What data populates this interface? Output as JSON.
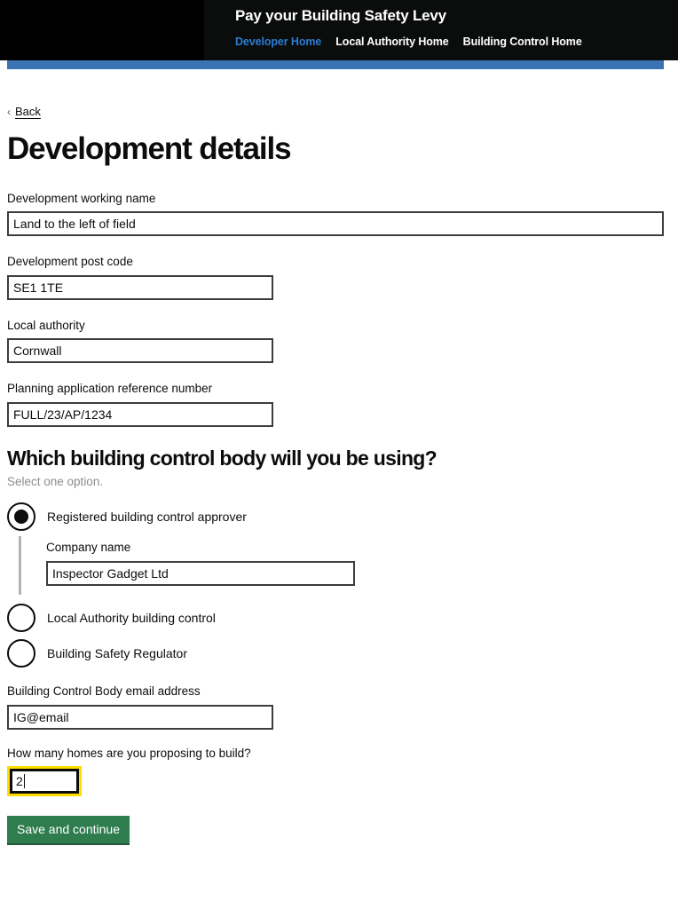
{
  "masthead": {
    "title": "Pay your Building Safety Levy",
    "nav": [
      {
        "label": "Developer Home",
        "active": true
      },
      {
        "label": "Local Authority Home",
        "active": false
      },
      {
        "label": "Building Control Home",
        "active": false
      }
    ],
    "accent_blue": "#3b74b5",
    "link_blue": "#2b7cd3",
    "background": "#0b0c0c"
  },
  "back": {
    "chevron": "chevron-left-icon",
    "label": "Back"
  },
  "page": {
    "title": "Development details"
  },
  "fields": {
    "working_name": {
      "label": "Development working name",
      "value": "Land to the left of field"
    },
    "post_code": {
      "label": "Development post code",
      "value": "SE1 1TE"
    },
    "local_authority": {
      "label": "Local authority",
      "value": "Cornwall"
    },
    "planning_reference": {
      "label": "Planning application reference number",
      "value": "FULL/23/AP/1234"
    },
    "bcb_email": {
      "label": "Building Control Body email address",
      "value": "IG@email"
    },
    "homes_count": {
      "label": "How many homes are you proposing to build?",
      "value": "2",
      "focused": true,
      "focus_color": "#ffdd00"
    }
  },
  "building_control": {
    "heading": "Which building control body will you be using?",
    "hint": "Select one option.",
    "options": [
      {
        "label": "Registered building control approver",
        "selected": true
      },
      {
        "label": "Local Authority building control",
        "selected": false
      },
      {
        "label": "Building Safety Regulator",
        "selected": false
      }
    ],
    "conditional": {
      "label": "Company name",
      "value": "Inspector Gadget Ltd"
    }
  },
  "actions": {
    "submit_label": "Save and continue",
    "submit_color": "#2f7d4f"
  }
}
